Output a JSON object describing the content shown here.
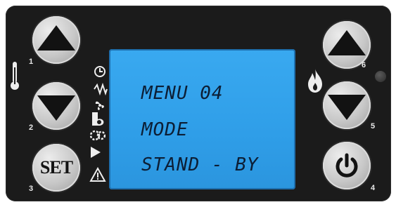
{
  "lcd": {
    "line1": "MENU 04",
    "line2": "MODE",
    "line3": "STAND - BY"
  },
  "buttons": {
    "b1": {
      "number": "1",
      "icon": "triangle-up-icon"
    },
    "b2": {
      "number": "2",
      "icon": "triangle-down-icon"
    },
    "b3": {
      "number": "3",
      "label": "SET"
    },
    "b4": {
      "number": "4",
      "icon": "power-icon"
    },
    "b5": {
      "number": "5",
      "icon": "triangle-down-icon"
    },
    "b6": {
      "number": "6",
      "icon": "triangle-up-icon"
    }
  },
  "side_icons": [
    "thermometer-icon",
    "clock-icon",
    "zigzag-icon",
    "fan-icon",
    "b-icon",
    "gear-icon",
    "play-icon",
    "warning-icon",
    "flame-icon"
  ],
  "colors": {
    "panel": "#1b1b1b",
    "lcd": "#39a9f0",
    "lcd_text": "#0c1e35",
    "button": "#c8c8c8"
  }
}
